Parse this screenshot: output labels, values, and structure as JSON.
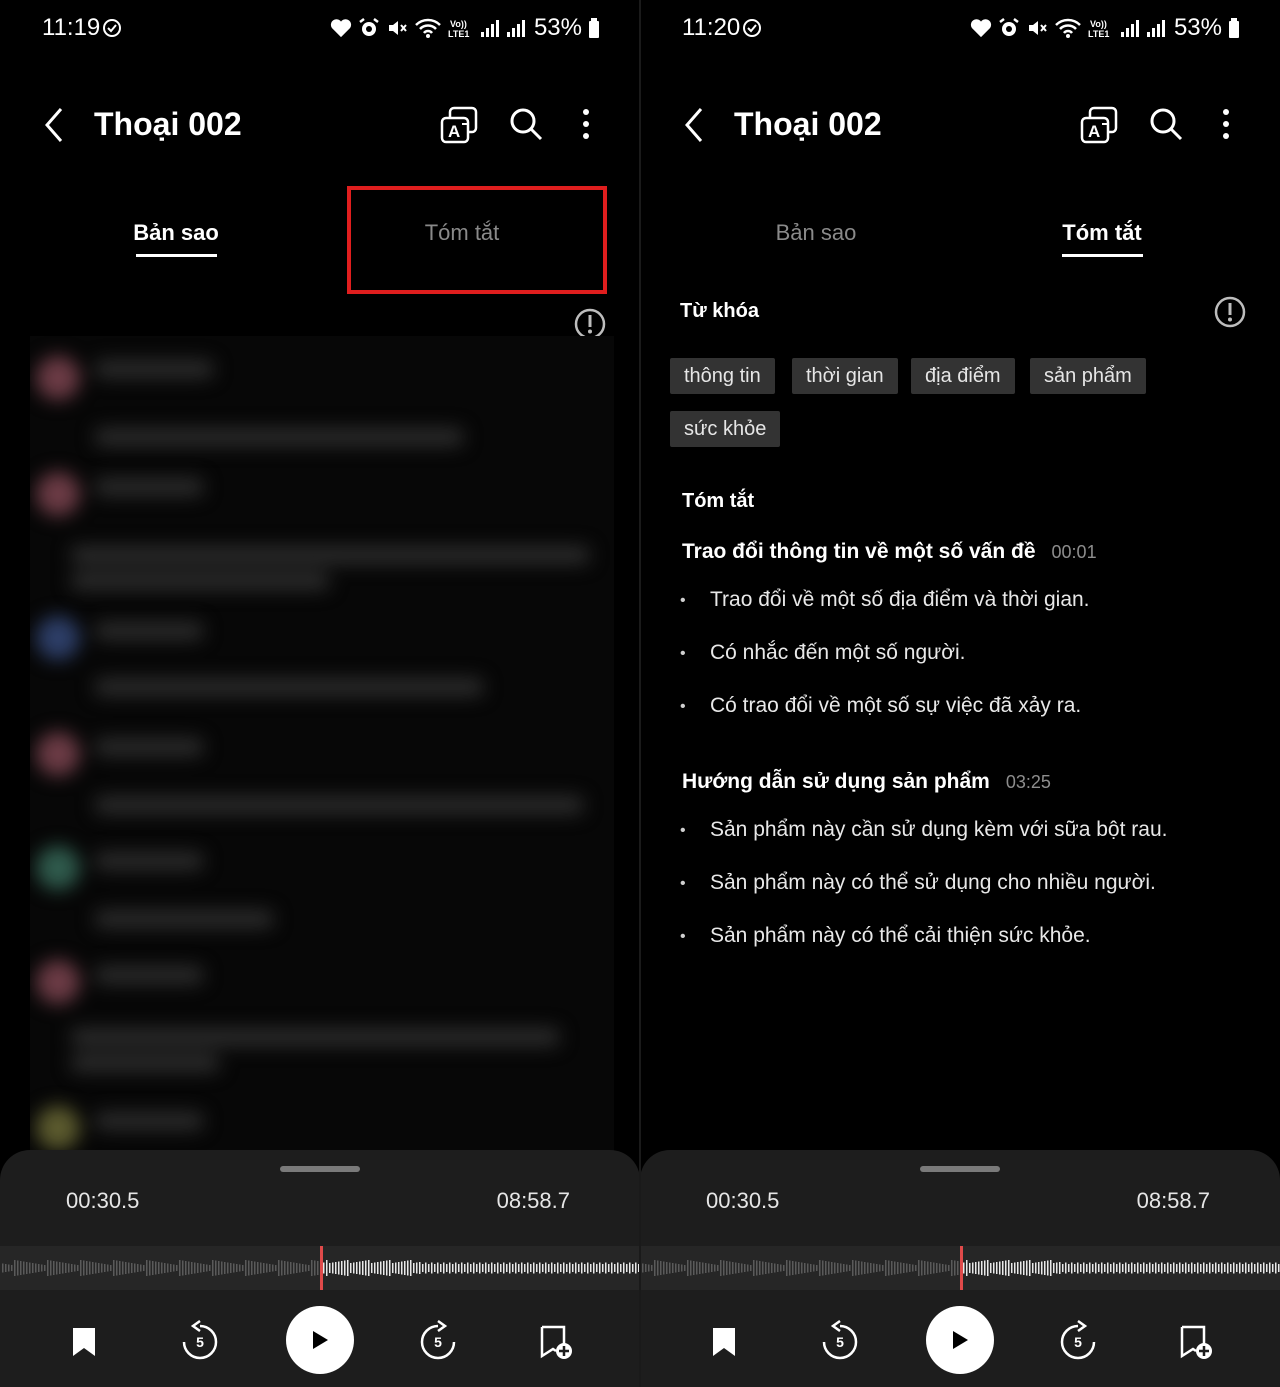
{
  "left": {
    "status": {
      "time": "11:19",
      "battery": "53%",
      "lte_label": "VoLTE1"
    },
    "app_bar": {
      "title": "Thoại 002"
    },
    "tabs": {
      "transcript": "Bản sao",
      "summary": "Tóm tắt"
    },
    "player": {
      "current": "00:30.5",
      "total": "08:58.7",
      "skip_back": "5",
      "skip_fwd": "5"
    }
  },
  "right": {
    "status": {
      "time": "11:20",
      "battery": "53%",
      "lte_label": "VoLTE1"
    },
    "app_bar": {
      "title": "Thoại 002"
    },
    "tabs": {
      "transcript": "Bản sao",
      "summary": "Tóm tắt"
    },
    "keywords": {
      "title": "Từ khóa",
      "items": [
        "thông tin",
        "thời gian",
        "địa điểm",
        "sản phẩm",
        "sức khỏe"
      ]
    },
    "summary": {
      "title": "Tóm tắt",
      "sections": [
        {
          "heading": "Trao đổi thông tin về một số vấn đề",
          "time": "00:01",
          "bullets": [
            "Trao đổi về một số địa điểm và thời gian.",
            "Có nhắc đến một số người.",
            "Có trao đổi về một số sự việc đã xảy ra."
          ]
        },
        {
          "heading": "Hướng dẫn sử dụng sản phẩm",
          "time": "03:25",
          "bullets": [
            "Sản phẩm này cần sử dụng kèm với sữa bột rau.",
            "Sản phẩm này có thể sử dụng cho nhiều người.",
            "Sản phẩm này có thể cải thiện sức khỏe."
          ]
        }
      ]
    },
    "player": {
      "current": "00:30.5",
      "total": "08:58.7",
      "skip_back": "5",
      "skip_fwd": "5"
    }
  },
  "colors": {
    "background": "#000000",
    "player_bg": "#1d1d1d",
    "chip_bg": "#333333",
    "highlight": "#e01e1e",
    "playhead": "#e04a4a",
    "inactive_text": "#8a8a8a"
  },
  "icons": [
    "check-circle-icon",
    "heart-icon",
    "alarm-icon",
    "mute-icon",
    "wifi-icon",
    "signal-icon",
    "battery-icon",
    "back-arrow-icon",
    "translate-icon",
    "search-icon",
    "more-vert-icon",
    "info-icon",
    "bookmark-icon",
    "replay-5-icon",
    "play-icon",
    "forward-5-icon",
    "bookmark-add-icon"
  ]
}
